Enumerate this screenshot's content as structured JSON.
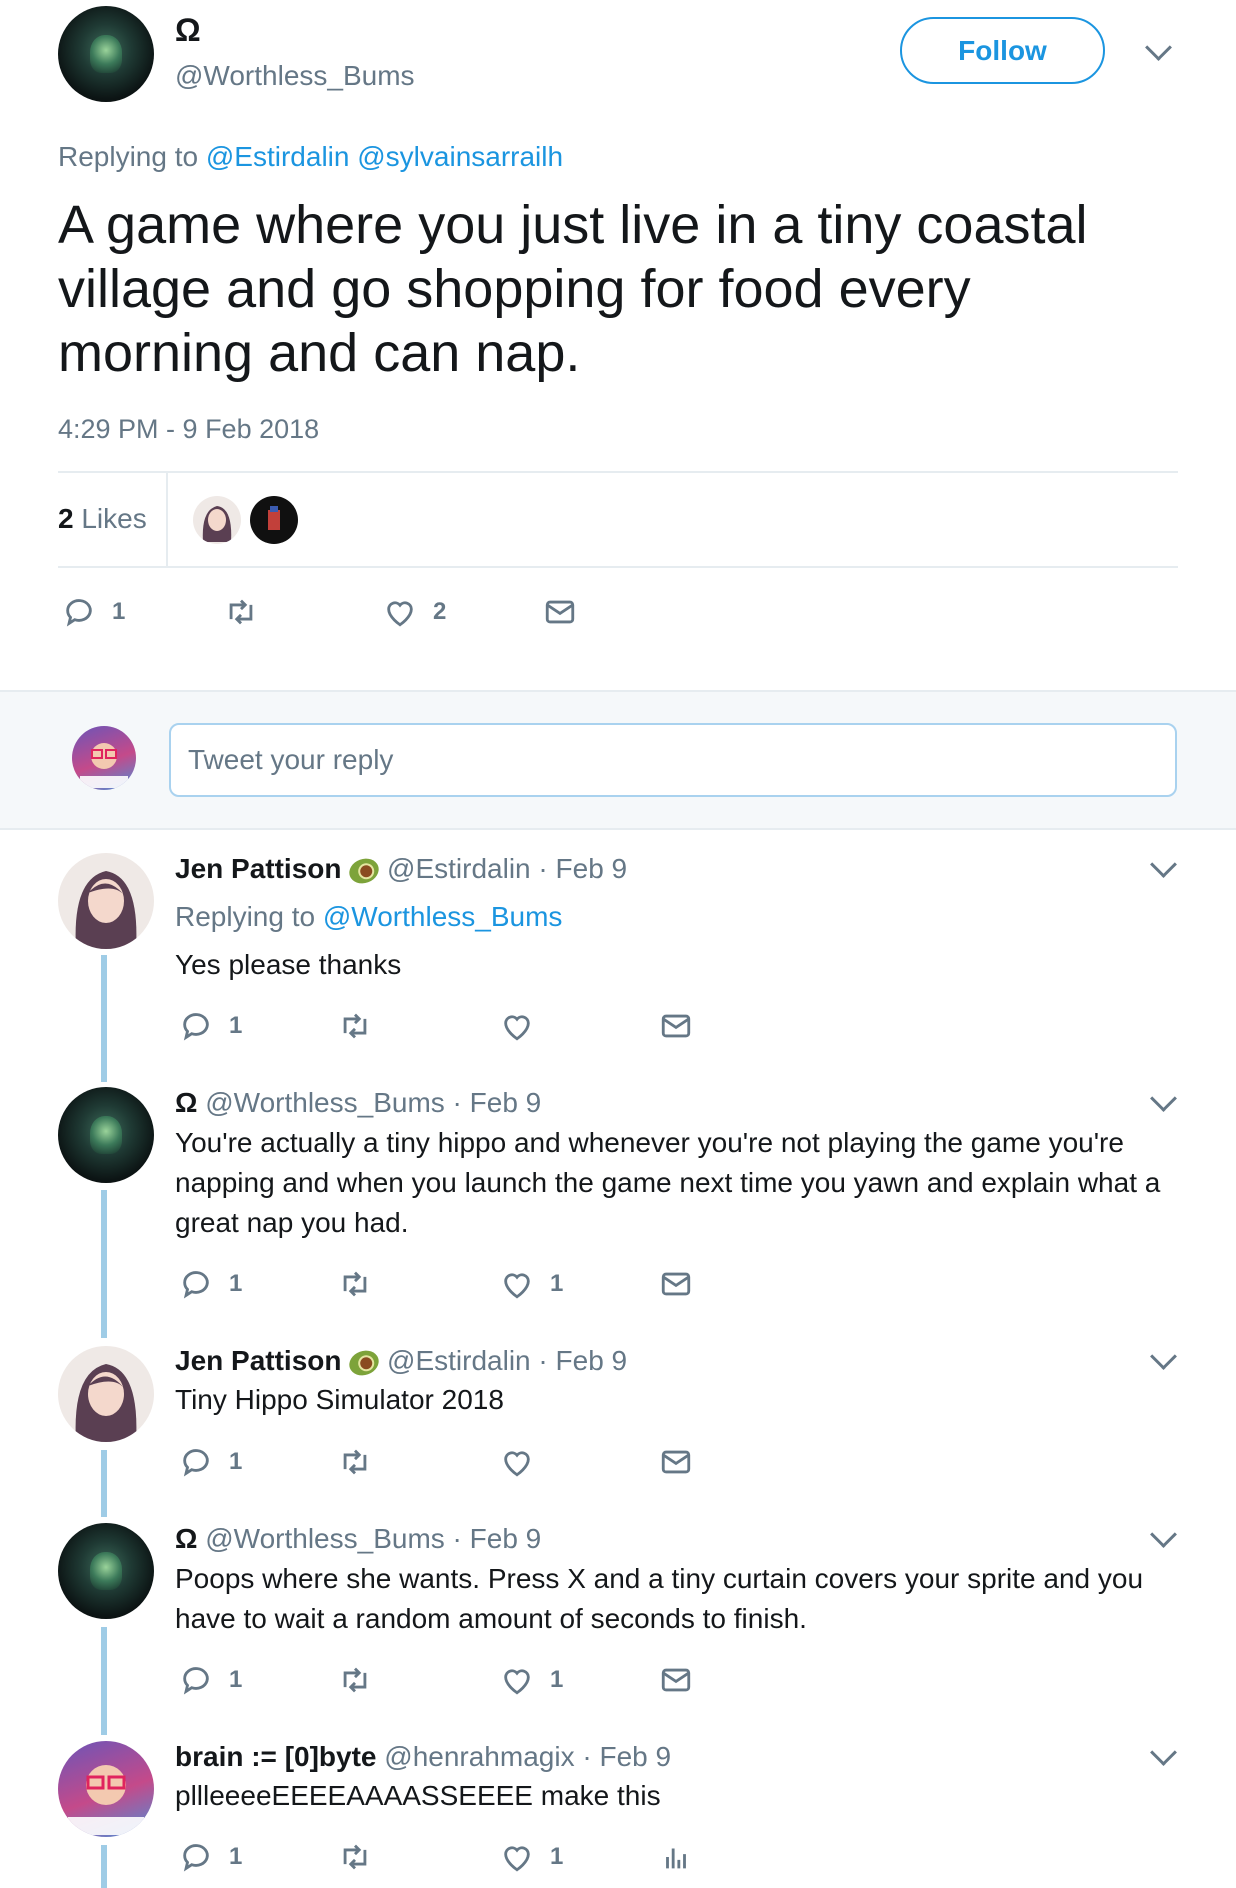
{
  "tweet": {
    "author_name": "Ω",
    "author_handle": "@Worthless_Bums",
    "follow_label": "Follow",
    "replying_prefix": "Replying to",
    "replying_to": [
      "@Estirdalin",
      "@sylvainsarrailh"
    ],
    "text": "A game where you just live in a tiny coastal village and go shopping for food every morning and can nap.",
    "timestamp": "4:29 PM - 9 Feb 2018",
    "likes_count": "2",
    "likes_label": "Likes",
    "actions": {
      "reply_count": "1",
      "retweet_count": "",
      "like_count": "2"
    }
  },
  "composer": {
    "placeholder": "Tweet your reply"
  },
  "replies": [
    {
      "name": "Jen Pattison",
      "handle": "@Estirdalin",
      "date": "· Feb 9",
      "replying_prefix": "Replying to",
      "replying_to": "@Worthless_Bums",
      "text": "Yes please thanks",
      "reply_count": "1",
      "like_count": ""
    },
    {
      "name": "Ω",
      "handle": "@Worthless_Bums",
      "date": "· Feb 9",
      "text": "You're actually a tiny hippo and whenever you're not playing the game you're napping and when you launch the game next time you yawn and explain what a great nap you had.",
      "reply_count": "1",
      "like_count": "1"
    },
    {
      "name": "Jen Pattison",
      "handle": "@Estirdalin",
      "date": "· Feb 9",
      "text": "Tiny Hippo Simulator 2018",
      "reply_count": "1",
      "like_count": ""
    },
    {
      "name": "Ω",
      "handle": "@Worthless_Bums",
      "date": "· Feb 9",
      "text": "Poops where she wants. Press X and a tiny curtain covers your sprite and you have to wait a random amount of seconds to finish.",
      "reply_count": "1",
      "like_count": "1"
    },
    {
      "name": "brain := [0]byte",
      "handle": "@henrahmagix",
      "date": "· Feb 9",
      "text": "pllleeeeEEEEAAAASSEEEE make this",
      "reply_count": "1",
      "like_count": "1"
    }
  ]
}
